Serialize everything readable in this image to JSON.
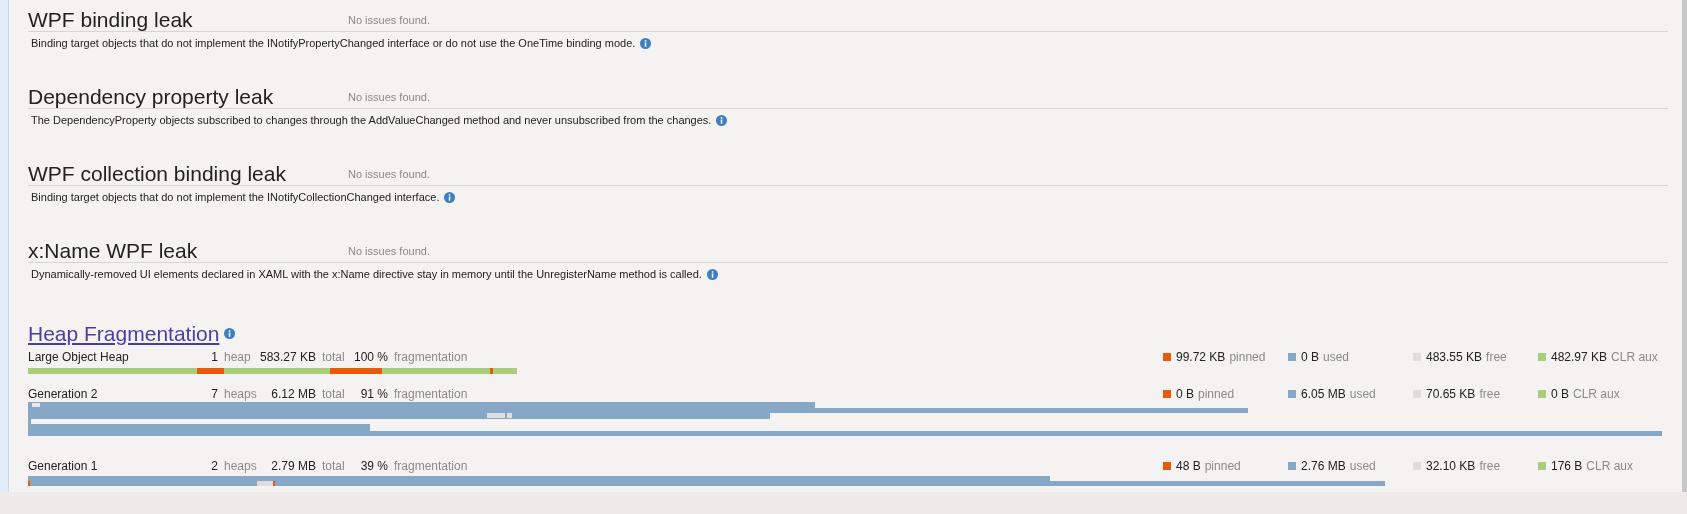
{
  "analyses": [
    {
      "title": "WPF binding leak",
      "result": "No issues found.",
      "description": "Binding target objects that do not implement the INotifyPropertyChanged interface or do not use the OneTime binding mode."
    },
    {
      "title": "Dependency property leak",
      "result": "No issues found.",
      "description": "The DependencyProperty objects subscribed to changes through the AddValueChanged method and never unsubscribed from the changes."
    },
    {
      "title": "WPF collection binding leak",
      "result": "No issues found.",
      "description": "Binding target objects that do not implement the INotifyCollectionChanged interface."
    },
    {
      "title": "x:Name WPF leak",
      "result": "No issues found.",
      "description": "Dynamically-removed UI elements declared in XAML with the x:Name directive stay in memory until the UnregisterName method is called."
    }
  ],
  "heap_fragmentation": {
    "title": "Heap Fragmentation",
    "rows": [
      {
        "kind": "loh",
        "name": "Large Object Heap",
        "count": "1",
        "count_unit": "heap",
        "total": "583.27 KB",
        "total_unit": "total",
        "percent": "100 %",
        "percent_unit": "fragmentation",
        "legend": [
          {
            "value": "99.72 KB",
            "label": "pinned",
            "color": "#e8590c"
          },
          {
            "value": "0 B",
            "label": "used",
            "color": "#86a8c6"
          },
          {
            "value": "483.55 KB",
            "label": "free",
            "color": "#dedede"
          },
          {
            "value": "482.97 KB",
            "label": "CLR aux",
            "color": "#a9cd7a"
          }
        ]
      },
      {
        "kind": "gen2",
        "name": "Generation 2",
        "count": "7",
        "count_unit": "heaps",
        "total": "6.12 MB",
        "total_unit": "total",
        "percent": "91 %",
        "percent_unit": "fragmentation",
        "legend": [
          {
            "value": "0 B",
            "label": "pinned",
            "color": "#e8590c"
          },
          {
            "value": "6.05 MB",
            "label": "used",
            "color": "#86a8c6"
          },
          {
            "value": "70.65 KB",
            "label": "free",
            "color": "#dedede"
          },
          {
            "value": "0 B",
            "label": "CLR aux",
            "color": "#a9cd7a"
          }
        ]
      },
      {
        "kind": "gen1",
        "name": "Generation 1",
        "count": "2",
        "count_unit": "heaps",
        "total": "2.79 MB",
        "total_unit": "total",
        "percent": "39 %",
        "percent_unit": "fragmentation",
        "legend": [
          {
            "value": "48 B",
            "label": "pinned",
            "color": "#e8590c"
          },
          {
            "value": "2.76 MB",
            "label": "used",
            "color": "#86a8c6"
          },
          {
            "value": "32.10 KB",
            "label": "free",
            "color": "#dedede"
          },
          {
            "value": "176 B",
            "label": "CLR aux",
            "color": "#a9cd7a"
          }
        ]
      }
    ]
  }
}
